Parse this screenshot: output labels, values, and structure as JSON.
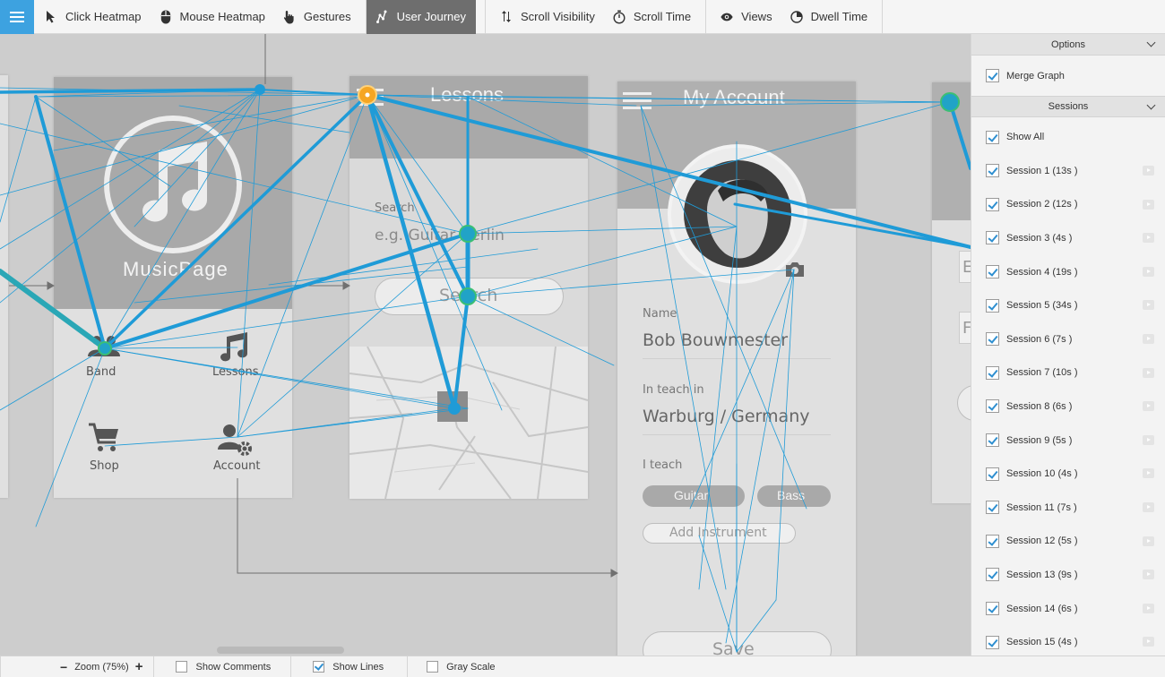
{
  "toolbar": {
    "items": [
      {
        "label": "Click Heatmap",
        "icon": "cursor-icon"
      },
      {
        "label": "Mouse Heatmap",
        "icon": "mouse-icon"
      },
      {
        "label": "Gestures",
        "icon": "hand-icon"
      },
      {
        "label": "User Journey",
        "icon": "journey-icon",
        "active": true
      },
      {
        "label": "Scroll Visibility",
        "icon": "scroll-arrows-icon"
      },
      {
        "label": "Scroll Time",
        "icon": "stopwatch-icon"
      },
      {
        "label": "Views",
        "icon": "eye-icon"
      },
      {
        "label": "Dwell Time",
        "icon": "pie-icon"
      }
    ],
    "accent": "#3da2e0"
  },
  "screens": {
    "music": {
      "title": "MusicPage",
      "tiles": {
        "band": "Band",
        "lessons": "Lessons",
        "shop": "Shop",
        "account": "Account"
      }
    },
    "lessons": {
      "title": "Lessons",
      "search_label": "Search",
      "search_placeholder": "e.g. Guitar Berlin",
      "search_button": "Search"
    },
    "account": {
      "title": "My Account",
      "name_label": "Name",
      "name_value": "Bob Bouwmester",
      "location_label": "In teach in",
      "location_value": "Warburg / Germany",
      "teach_label": "I teach",
      "tags": [
        "Guitar",
        "Bass"
      ],
      "add_button": "Add Instrument",
      "save_button": "Save"
    },
    "partial": {
      "field1": "E",
      "field2": "F"
    }
  },
  "panel": {
    "options_title": "Options",
    "merge_graph": {
      "label": "Merge Graph",
      "checked": true
    },
    "sessions_title": "Sessions",
    "show_all": {
      "label": "Show All",
      "checked": true
    },
    "sessions": [
      "Session 1 (13s )",
      "Session 2 (12s )",
      "Session 3 (4s )",
      "Session 4 (19s )",
      "Session 5 (34s )",
      "Session 6 (7s )",
      "Session 7 (10s )",
      "Session 8 (6s )",
      "Session 9 (5s )",
      "Session 10 (4s )",
      "Session 11 (7s )",
      "Session 12 (5s )",
      "Session 13 (9s )",
      "Session 14 (6s )",
      "Session 15 (4s )"
    ]
  },
  "status": {
    "zoom_label": "Zoom (75%)",
    "zoom_out": "−",
    "zoom_in": "+",
    "show_comments": {
      "label": "Show Comments",
      "checked": false
    },
    "show_lines": {
      "label": "Show Lines",
      "checked": true
    },
    "gray_scale": {
      "label": "Gray Scale",
      "checked": false
    }
  },
  "journey": {
    "line_color": "#1f9bd7",
    "node_color": "#21a3c7",
    "start_color": "#f5a623"
  }
}
